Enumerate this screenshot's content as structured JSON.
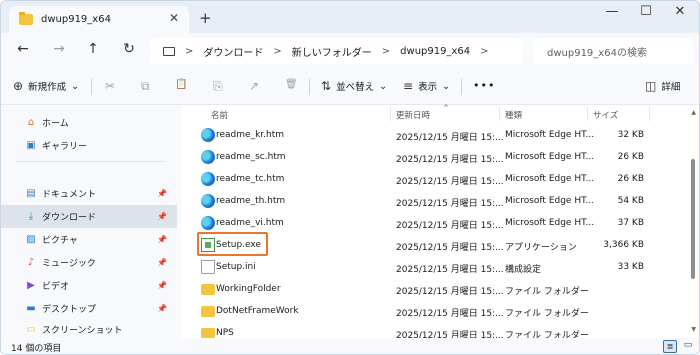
{
  "window": {
    "tab_title": "dwup919_x64",
    "close_glyph": "✕",
    "new_tab_glyph": "+",
    "minimize_glyph": "—",
    "maximize_glyph": "☐",
    "close_window_glyph": "✕"
  },
  "address": {
    "back": "←",
    "forward": "→",
    "up": "↑",
    "refresh": "↻",
    "crumbs": [
      "ダウンロード",
      "新しいフォルダー",
      "dwup919_x64"
    ],
    "sep": ">",
    "more": ">",
    "search_placeholder": "dwup919_x64の検索",
    "search_icon": "⌕"
  },
  "toolbar": {
    "new_label": "新規作成",
    "new_icon": "⊕",
    "chevron": "⌄",
    "cut_icon": "✂",
    "copy_icon": "⧉",
    "paste_icon": "📋",
    "rename_icon": "⎘",
    "share_icon": "↗",
    "delete_icon": "🗑",
    "sort_label": "並べ替え",
    "sort_icon": "⇅",
    "view_label": "表示",
    "view_icon": "≡",
    "more_label": "•••",
    "details_label": "詳細",
    "details_icon": "◫"
  },
  "sidebar": {
    "items": [
      {
        "label": "ホーム",
        "icon": "⌂"
      },
      {
        "label": "ギャラリー",
        "icon": "▣"
      },
      {
        "label": "ドキュメント",
        "icon": "▤",
        "pin": "📌"
      },
      {
        "label": "ダウンロード",
        "icon": "⤓",
        "pin": "📌"
      },
      {
        "label": "ピクチャ",
        "icon": "▨",
        "pin": "📌"
      },
      {
        "label": "ミュージック",
        "icon": "♪",
        "pin": "📌"
      },
      {
        "label": "ビデオ",
        "icon": "▶",
        "pin": "📌"
      },
      {
        "label": "デスクトップ",
        "icon": "▬",
        "pin": "📌"
      },
      {
        "label": "スクリーンショット",
        "icon": "▭"
      }
    ]
  },
  "columns": {
    "name": "名前",
    "modified": "更新日時",
    "type": "種類",
    "size": "サイズ",
    "sort_caret": "^"
  },
  "files": [
    {
      "name": "readme_kr.htm",
      "date": "2025/12/15 月曜日 15:...",
      "type": "Microsoft Edge HT...",
      "size": "32 KB",
      "kind": "edge"
    },
    {
      "name": "readme_sc.htm",
      "date": "2025/12/15 月曜日 15:...",
      "type": "Microsoft Edge HT...",
      "size": "26 KB",
      "kind": "edge"
    },
    {
      "name": "readme_tc.htm",
      "date": "2025/12/15 月曜日 15:...",
      "type": "Microsoft Edge HT...",
      "size": "26 KB",
      "kind": "edge"
    },
    {
      "name": "readme_th.htm",
      "date": "2025/12/15 月曜日 15:...",
      "type": "Microsoft Edge HT...",
      "size": "54 KB",
      "kind": "edge"
    },
    {
      "name": "readme_vi.htm",
      "date": "2025/12/15 月曜日 15:...",
      "type": "Microsoft Edge HT...",
      "size": "37 KB",
      "kind": "edge"
    },
    {
      "name": "Setup.exe",
      "date": "2025/12/15 月曜日 15:...",
      "type": "アプリケーション",
      "size": "3,366 KB",
      "kind": "exe"
    },
    {
      "name": "Setup.ini",
      "date": "2025/12/15 月曜日 15:...",
      "type": "構成設定",
      "size": "33 KB",
      "kind": "ini"
    },
    {
      "name": "WorkingFolder",
      "date": "2025/12/15 月曜日 15:...",
      "type": "ファイル フォルダー",
      "size": "",
      "kind": "folder"
    },
    {
      "name": "DotNetFrameWork",
      "date": "2025/12/15 月曜日 15:...",
      "type": "ファイル フォルダー",
      "size": "",
      "kind": "folder"
    },
    {
      "name": "NPS",
      "date": "2025/12/15 月曜日 15:...",
      "type": "ファイル フォルダー",
      "size": "",
      "kind": "folder"
    }
  ],
  "status": {
    "count": "14 個の項目",
    "view_details_icon": "≣",
    "view_tiles_icon": "▭"
  }
}
